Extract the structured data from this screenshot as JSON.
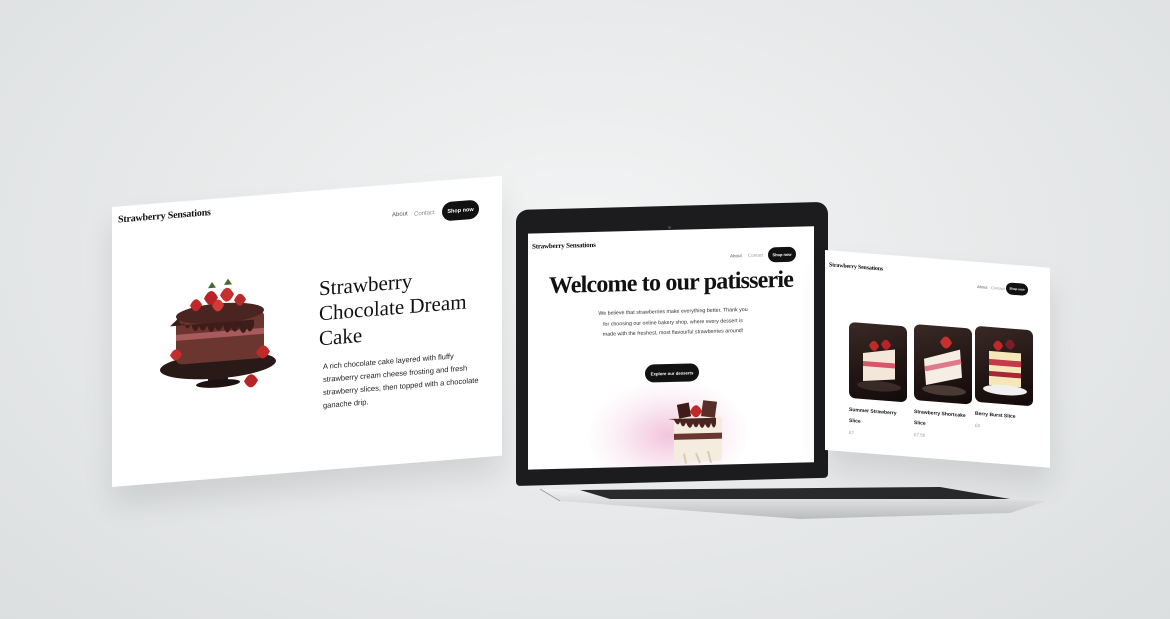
{
  "brand": "Strawberry Sensations",
  "nav": {
    "about": "About",
    "contact": "Contact",
    "shop_now": "Shop now"
  },
  "left_page": {
    "title_line1": "Strawberry",
    "title_line2": "Chocolate Dream",
    "title_line3": "Cake",
    "description": "A rich chocolate cake layered with fluffy strawberry cream cheese frosting and fresh strawberry slices, then topped with a chocolate ganache drip.",
    "image": "chocolate-strawberry-cake-icon"
  },
  "laptop_page": {
    "headline": "Welcome to our patisserie",
    "intro": "We believe that strawberries make everything better. Thank you for choosing our online bakery shop, where every dessert is made with the freshest, most flavourful strawberries around!",
    "cta": "Explore our desserts",
    "image": "strawberry-dessert-icon"
  },
  "right_page": {
    "products": [
      {
        "name": "Summer Strawberry Slice",
        "price": "£7"
      },
      {
        "name": "Strawberry Shortcake Slice",
        "price": "£7.50"
      },
      {
        "name": "Berry Burst Slice",
        "price": "£8"
      }
    ]
  },
  "colors": {
    "background": "#e6e8e9",
    "button": "#111111",
    "accent_pink": "#e896be",
    "strawberry_red": "#c0282a",
    "chocolate": "#5a2e28"
  }
}
